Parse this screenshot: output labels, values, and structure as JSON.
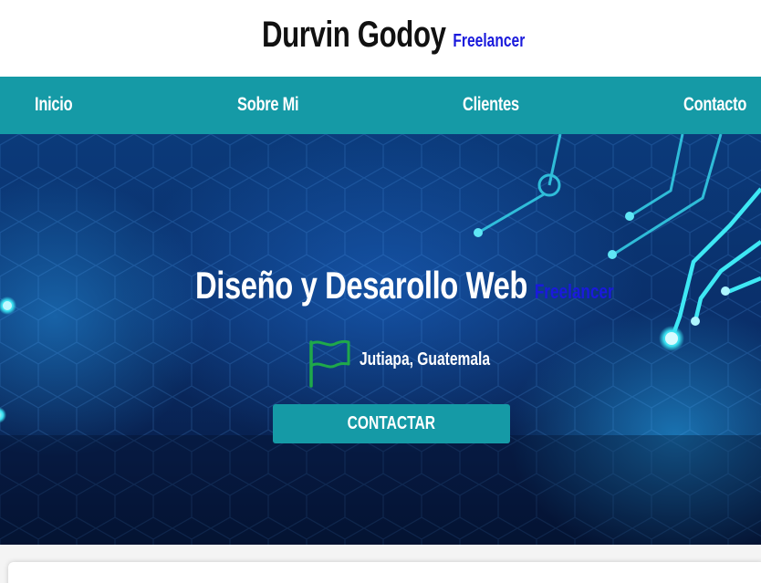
{
  "header": {
    "title": "Durvin Godoy",
    "tagline": "Freelancer"
  },
  "nav": {
    "items": [
      {
        "label": "Inicio"
      },
      {
        "label": "Sobre Mi"
      },
      {
        "label": "Clientes"
      },
      {
        "label": "Contacto"
      }
    ]
  },
  "hero": {
    "title": "Diseño y Desarollo Web",
    "tagline": "Freelancer",
    "location": "Jutiapa, Guatemala",
    "flag_icon": "flag-icon",
    "cta_label": "CONTACTAR"
  },
  "colors": {
    "accent": "#159aa6",
    "tagline": "#1a1adc",
    "flag": "#1fa84a",
    "hero_dark": "#081f4c",
    "circuit": "#38e0f0"
  }
}
